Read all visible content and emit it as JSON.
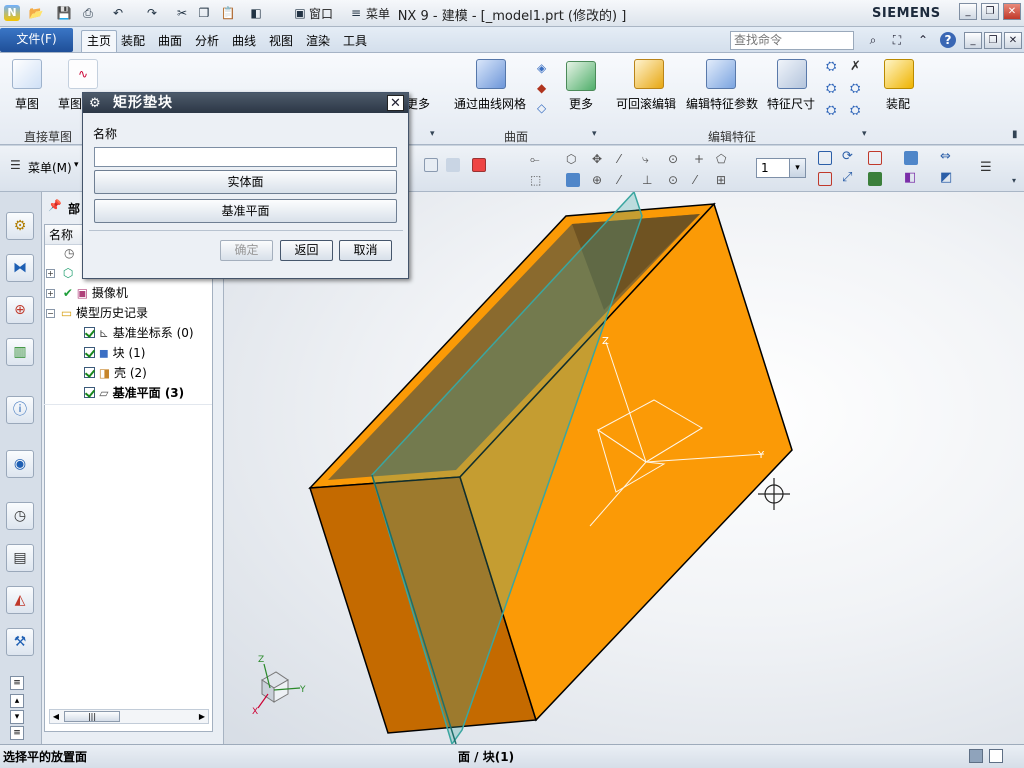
{
  "window": {
    "title": "NX 9 - 建模 - [_model1.prt  (修改的) ]",
    "brand": "SIEMENS"
  },
  "quick_access": {
    "window_label": "窗口",
    "menu_label": "菜单"
  },
  "menubar": {
    "file_label": "文件(F)",
    "tabs": [
      "主页",
      "装配",
      "曲面",
      "分析",
      "曲线",
      "视图",
      "渲染",
      "工具"
    ],
    "search_placeholder": "查找命令"
  },
  "ribbon": {
    "sketch": "草图",
    "sketch2": "草图",
    "direct_sketch": "直接草图",
    "more1": "更多",
    "through_curve_mesh": "通过曲线网格",
    "more2": "更多",
    "surface_group": "曲面",
    "rollback_edit": "可回滚编辑",
    "edit_feature_params": "编辑特征参数",
    "feature_size": "特征尺寸",
    "edit_feature_group": "编辑特征",
    "assembly": "装配"
  },
  "toolbar2": {
    "menu_button": "菜单(M)",
    "layer_value": "1"
  },
  "nav": {
    "header": "部",
    "column_name": "名称",
    "tree": [
      {
        "label": "摄像机"
      },
      {
        "label": "模型历史记录"
      },
      {
        "label": "基准坐标系",
        "count": "(0)"
      },
      {
        "label": "块",
        "count": "(1)"
      },
      {
        "label": "壳",
        "count": "(2)"
      },
      {
        "label": "基准平面",
        "count": "(3)"
      }
    ]
  },
  "dialog": {
    "title": "矩形垫块",
    "name_label": "名称",
    "name_value": "",
    "solid_face": "实体面",
    "datum_plane": "基准平面",
    "ok": "确定",
    "back": "返回",
    "cancel": "取消"
  },
  "status": {
    "prompt": "选择平的放置面",
    "selection": "面 / 块(1)"
  },
  "colors": {
    "block_face": "#fb9a06",
    "block_side": "#c46a00",
    "datum_plane": "#3aa6a0",
    "accent": "#2a5fae"
  }
}
